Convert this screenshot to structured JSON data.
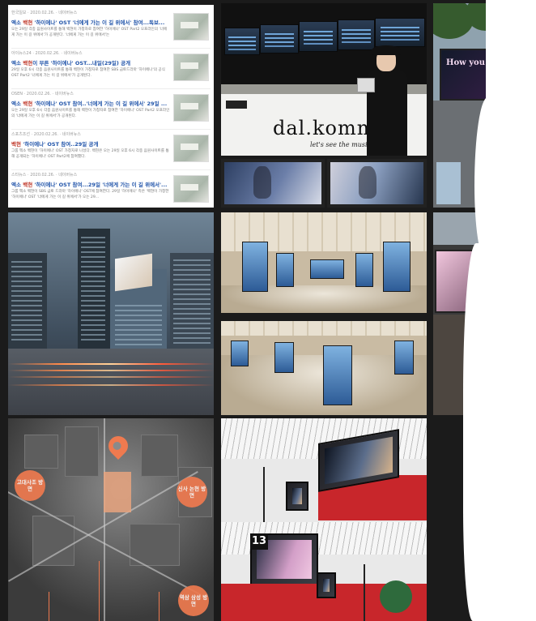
{
  "news": {
    "items": [
      {
        "source": "한국일보",
        "date": "2020.02.26.",
        "tag": "네이버뉴스",
        "title_pre": "엑소 ",
        "title_hl": "백현",
        "title_mid": " '하이에나' OST '너에게 가는 이 길 위에서' 참여...독보...",
        "snippet": "오는 29일 각종 음원사이트를 통해 백현이 가창자로 참여한 '하이에나' OST Part2 오프라인의 '너에게 가는 이 길 위에서'가 공개된다. '너에게 가는 이 길 위에서'는"
      },
      {
        "source": "아이뉴스24",
        "date": "2020.02.26.",
        "tag": "네이버뉴스",
        "title_pre": "엑소 ",
        "title_hl": "백현",
        "title_mid": "이 부른 '하이에나' OST...내일(29일) 공개",
        "snippet": "29일 오후 6시 각종 음원사이트를 통해 백현이 가창자로 참여한 SBS 금토드라마 '하이에나'의 공식 OST Part2 '너에게 가는 이 길 위에서'가 공개된다."
      },
      {
        "source": "OSEN",
        "date": "2020.02.26.",
        "tag": "네이버뉴스",
        "title_pre": "엑소 ",
        "title_hl": "백현",
        "title_mid": " '하이에나' OST 참여..'너에게 가는 이 길 위에서' 29일 ...",
        "snippet": "오는 29일 오후 6시 각종 음원사이트를 통해 백현이 가창자로 참여한 '하이에나' OST Part2 오프라인의 '너에게 가는 이 길 위에서'가 공개된다."
      },
      {
        "source": "스포츠조선",
        "date": "2020.02.26.",
        "tag": "네이버뉴스",
        "title_pre": "",
        "title_hl": "백현",
        "title_mid": " '하이에나' OST 참여..29일 공개",
        "snippet": "그룹 엑소 백현이 '하이에나' OST 가창자로 나섰다. 백현은 오는 29일 오후 6시 각종 음원사이트를 통해 공개되는 '하이에나' OST Part2에 참여했다."
      },
      {
        "source": "스타뉴스",
        "date": "2020.02.26.",
        "tag": "네이버뉴스",
        "title_pre": "엑소 ",
        "title_hl": "백현",
        "title_mid": " '하이에나' OST 참여...29일 '너에게 가는 이 길 위에서'...",
        "snippet": "그룹 엑소 백현이 SBS 금토 드라마 '하이에나' OST에 참여한다. 29일 '하이에나' 측은 '백현이 가창한 '하이에나' OST '너에게 가는 이 길 위에서'가 오는 29..."
      }
    ]
  },
  "cafe": {
    "brand": "dal.komm",
    "tagline": "let's see the music"
  },
  "billboard": {
    "text": "How you like that"
  },
  "map": {
    "labels": [
      "고대사조 방면",
      "신사 논현 방면",
      "역삼 삼성 방면"
    ]
  },
  "terminal": {
    "gate": "13"
  },
  "colors": {
    "accent": "#ef7a4f",
    "link": "#2255aa",
    "highlight": "#c0392b",
    "background": "#1b1b1b"
  }
}
